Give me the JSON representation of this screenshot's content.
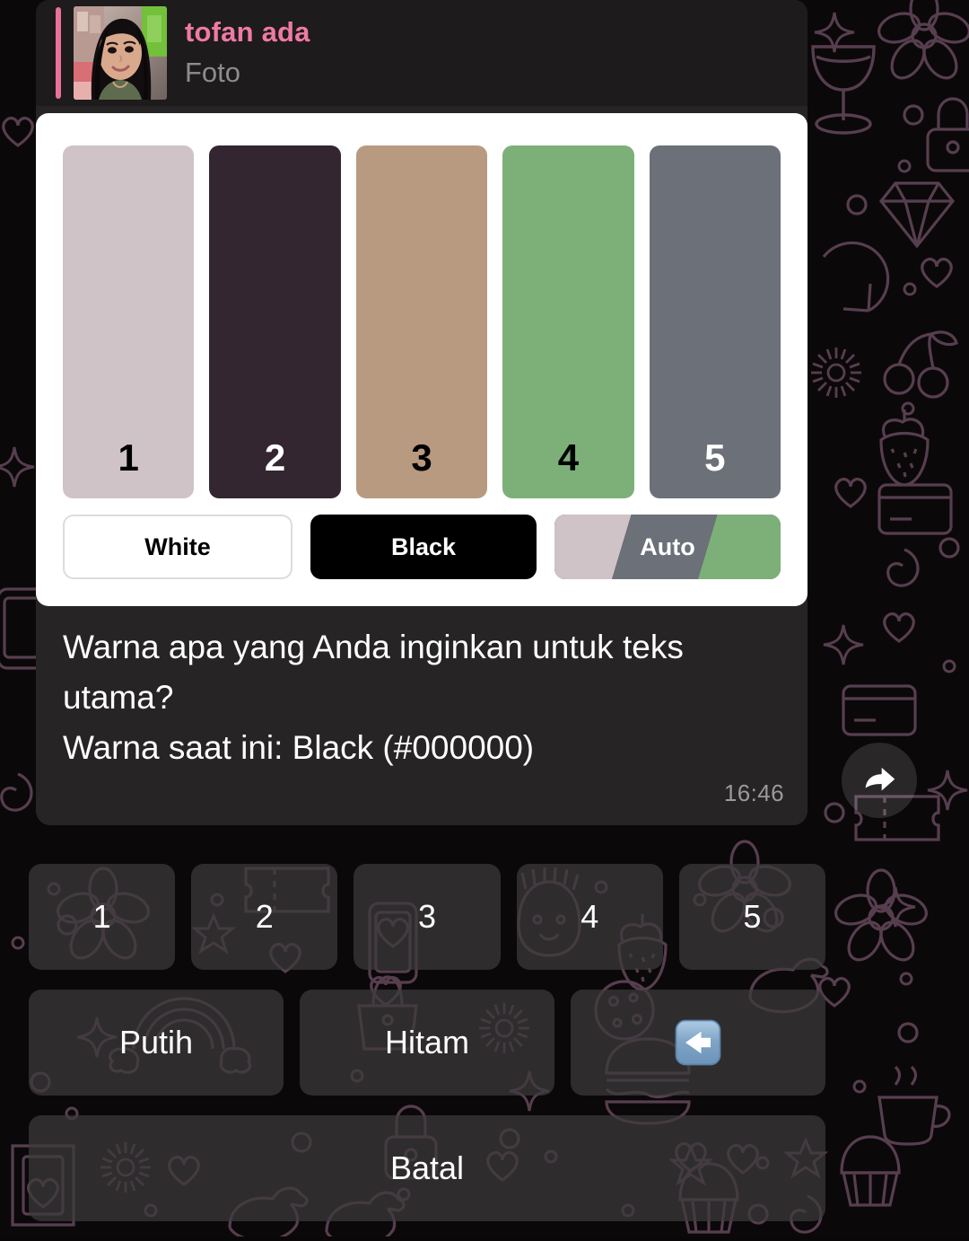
{
  "reply": {
    "sender_name": "tofan ada",
    "content_type": "Foto",
    "accent_color": "#ef7aa4"
  },
  "palette_card": {
    "swatches": [
      {
        "number": "1",
        "color": "#cfc3c7",
        "num_color": "#000000"
      },
      {
        "number": "2",
        "color": "#332630",
        "num_color": "#ffffff"
      },
      {
        "number": "3",
        "color": "#b89a81",
        "num_color": "#000000"
      },
      {
        "number": "4",
        "color": "#7db078",
        "num_color": "#000000"
      },
      {
        "number": "5",
        "color": "#6b7079",
        "num_color": "#ffffff"
      }
    ],
    "modes": [
      {
        "label": "White",
        "style": "white"
      },
      {
        "label": "Black",
        "style": "black"
      },
      {
        "label": "Auto",
        "style": "auto"
      }
    ],
    "auto_stripes": [
      "#cfc3c7",
      "#6b7079",
      "#7db078"
    ]
  },
  "message": {
    "text": "Warna apa yang Anda inginkan untuk teks utama?\nWarna saat ini: Black (#000000)",
    "time": "16:46",
    "bubble_color": "#262425",
    "text_color": "#ffffff"
  },
  "keyboard": {
    "row1": [
      {
        "label": "1"
      },
      {
        "label": "2"
      },
      {
        "label": "3"
      },
      {
        "label": "4"
      },
      {
        "label": "5"
      }
    ],
    "row2": [
      {
        "label": "Putih"
      },
      {
        "label": "Hitam"
      },
      {
        "label": "",
        "icon": "left-arrow-emoji"
      }
    ],
    "row3": [
      {
        "label": "Batal"
      }
    ]
  },
  "actions": {
    "forward_icon": "forward-arrow-icon"
  }
}
